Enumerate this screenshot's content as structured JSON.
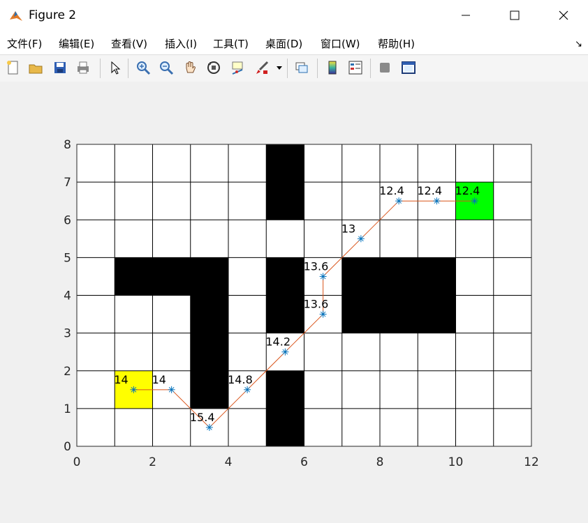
{
  "window": {
    "title": "Figure 2",
    "controls": [
      "minimize",
      "maximize",
      "close"
    ]
  },
  "menu": {
    "items": [
      "文件(F)",
      "编辑(E)",
      "查看(V)",
      "插入(I)",
      "工具(T)",
      "桌面(D)",
      "窗口(W)",
      "帮助(H)"
    ]
  },
  "toolbar": {
    "icons": [
      "new-figure-icon",
      "open-file-icon",
      "save-icon",
      "print-icon",
      "pointer-icon",
      "zoom-in-icon",
      "zoom-out-icon",
      "pan-icon",
      "rotate-3d-icon",
      "data-cursor-icon",
      "brush-icon",
      "link-plot-icon",
      "colorbar-icon",
      "legend-icon",
      "hide-plot-tools-icon",
      "show-plot-tools-icon"
    ]
  },
  "chart_data": {
    "type": "scatter",
    "xlim": [
      0,
      12
    ],
    "ylim": [
      0,
      8
    ],
    "xticks": [
      "0",
      "2",
      "4",
      "6",
      "8",
      "10",
      "12"
    ],
    "yticks": [
      "0",
      "1",
      "2",
      "3",
      "4",
      "5",
      "6",
      "7",
      "8"
    ],
    "grid": true,
    "obstacles": [
      [
        1,
        4
      ],
      [
        2,
        4
      ],
      [
        3,
        4
      ],
      [
        3,
        3
      ],
      [
        3,
        2
      ],
      [
        3,
        1
      ],
      [
        5,
        7
      ],
      [
        5,
        6
      ],
      [
        5,
        4
      ],
      [
        5,
        3
      ],
      [
        5,
        1
      ],
      [
        5,
        0
      ],
      [
        7,
        3
      ],
      [
        8,
        3
      ],
      [
        9,
        3
      ],
      [
        7,
        4
      ],
      [
        8,
        4
      ],
      [
        9,
        4
      ]
    ],
    "start_cell": [
      1,
      1
    ],
    "goal_cell": [
      10,
      6
    ],
    "start_color": "#ffff00",
    "goal_color": "#00ff00",
    "obstacle_color": "#000000",
    "path_color": "#d95319",
    "marker_color": "#0072bd",
    "path": [
      {
        "x": 1.5,
        "y": 1.5,
        "label": "14"
      },
      {
        "x": 2.5,
        "y": 1.5,
        "label": "14"
      },
      {
        "x": 3.5,
        "y": 0.5,
        "label": "15.4"
      },
      {
        "x": 4.5,
        "y": 1.5,
        "label": "14.8"
      },
      {
        "x": 5.5,
        "y": 2.5,
        "label": "14.2"
      },
      {
        "x": 6.5,
        "y": 3.5,
        "label": "13.6"
      },
      {
        "x": 6.5,
        "y": 4.5,
        "label": "13.6"
      },
      {
        "x": 7.5,
        "y": 5.5,
        "label": "13"
      },
      {
        "x": 8.5,
        "y": 6.5,
        "label": "12.4"
      },
      {
        "x": 9.5,
        "y": 6.5,
        "label": "12.4"
      },
      {
        "x": 10.5,
        "y": 6.5,
        "label": "12.4"
      }
    ]
  }
}
